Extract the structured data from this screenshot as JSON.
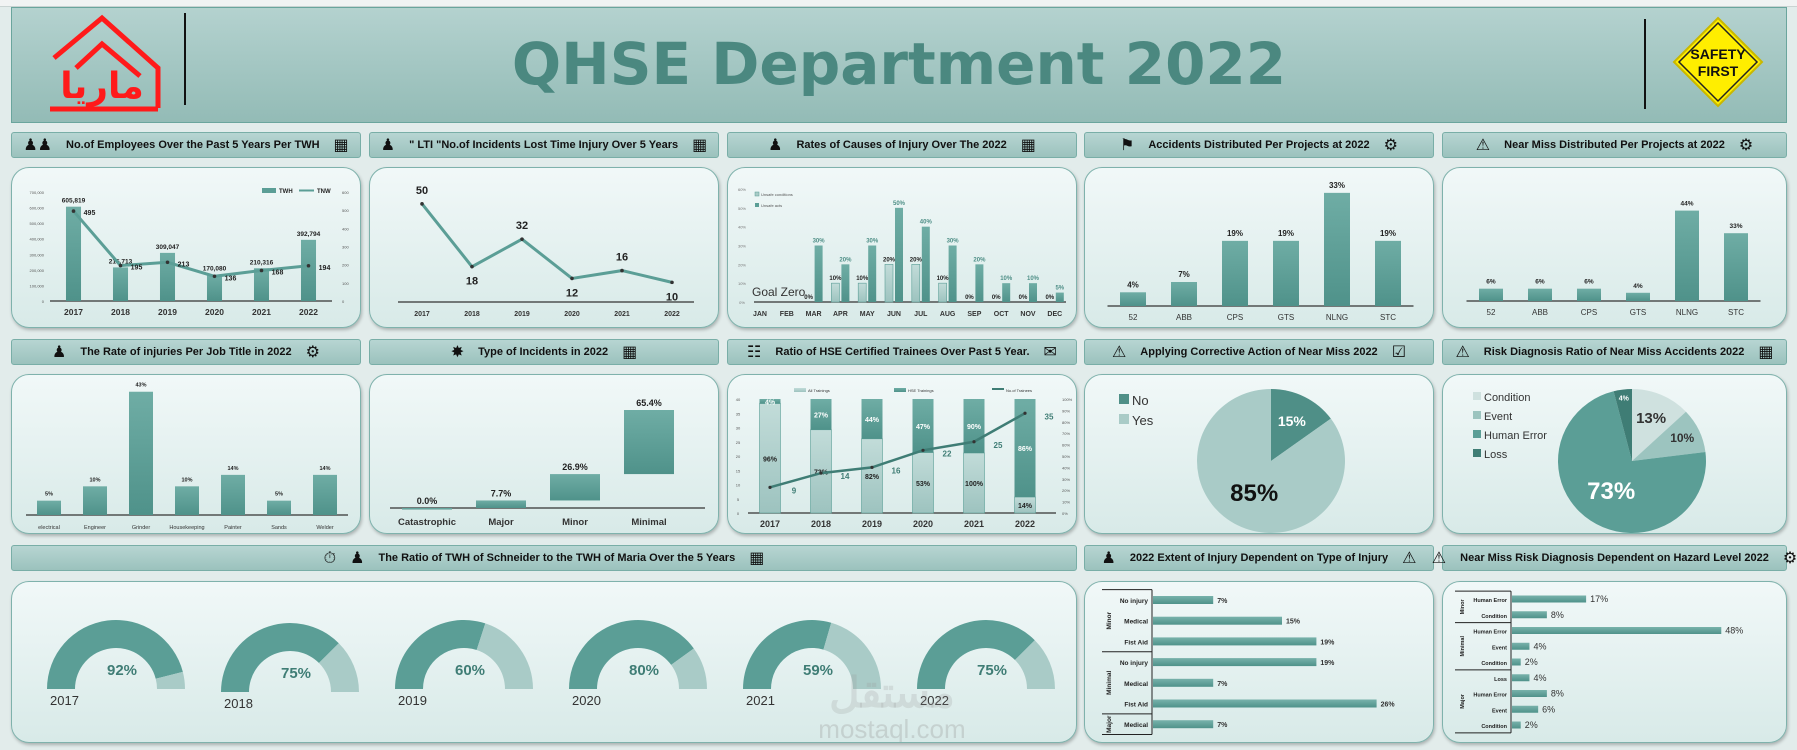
{
  "banner": {
    "title": "QHSE Department 2022",
    "logo_text": "ماريا",
    "sign_text": [
      "SAFETY",
      "FIRST"
    ],
    "watermark": [
      "مستقل",
      "mostaql.com"
    ]
  },
  "colors": {
    "bar": "#5b9e96",
    "bar_light": "#a9cbc7",
    "bar_dark": "#3f7d75",
    "title": "#4b8880",
    "logo": "#ff1a1a",
    "sign": "#ffee00"
  },
  "panels": [
    {
      "title": "No.of Employees Over the Past 5 Years Per TWH",
      "icons": [
        "people-icon",
        "calendar-clock-icon"
      ]
    },
    {
      "title": "\" LTI \"No.of Incidents Lost Time Injury Over 5 Years",
      "icons": [
        "injured-worker-icon",
        "calendar-clock-icon"
      ]
    },
    {
      "title": "Rates of Causes of Injury Over The 2022",
      "icons": [
        "injured-worker-icon",
        "calendar-clock-icon"
      ]
    },
    {
      "title": "Accidents Distributed Per Projects at 2022",
      "icons": [
        "falling-worker-icon",
        "gear-wrench-icon"
      ]
    },
    {
      "title": "Near Miss Distributed Per Projects at 2022",
      "icons": [
        "slipping-person-icon",
        "gear-wrench-icon"
      ]
    },
    {
      "title": "The Rate of injuries Per Job Title in 2022",
      "icons": [
        "injured-worker-icon",
        "gear-wrench-icon"
      ]
    },
    {
      "title": "Type of Incidents in 2022",
      "icons": [
        "accident-icon",
        "calendar-clock-icon"
      ]
    },
    {
      "title": "Ratio of HSE Certified Trainees Over Past 5 Year.",
      "icons": [
        "trainees-icon",
        "certificate-icon"
      ]
    },
    {
      "title": "Applying Corrective Action of Near Miss 2022",
      "icons": [
        "slipping-person-icon",
        "clipboard-check-icon"
      ]
    },
    {
      "title": "Risk Diagnosis Ratio of Near Miss Accidents 2022",
      "icons": [
        "slipping-person-icon",
        "calendar-clock-icon"
      ]
    },
    {
      "title": "The Ratio of TWH of Schneider to the TWH of Maria Over the 5 Years",
      "icons": [
        "stopwatch-icon",
        "worker-icon",
        "calendar-clock-icon"
      ]
    },
    {
      "title": "2022 Extent of Injury Dependent on Type of Injury",
      "icons": [
        "injured-worker-icon",
        "falling-person-icon"
      ]
    },
    {
      "title": "Near Miss Risk Diagnosis Dependent on Hazard Level 2022",
      "icons": [
        "slipping-person-icon",
        "gear-wrench-icon"
      ]
    }
  ],
  "chart_data": [
    {
      "type": "bar+line",
      "categories": [
        "2017",
        "2018",
        "2019",
        "2020",
        "2021",
        "2022"
      ],
      "series": [
        {
          "name": "TWH",
          "values": [
            605819,
            215713,
            309047,
            170080,
            210316,
            392794
          ],
          "axis": "left"
        },
        {
          "name": "TNW",
          "values": [
            495,
            195,
            213,
            136,
            168,
            194
          ],
          "axis": "right"
        }
      ],
      "ylim": [
        0,
        700000
      ],
      "y2lim": [
        0,
        600
      ],
      "yticks": [
        "0",
        "100,000",
        "200,000",
        "300,000",
        "400,000",
        "500,000",
        "600,000",
        "700,000"
      ],
      "y2ticks": [
        "0",
        "100",
        "200",
        "300",
        "400",
        "500",
        "600"
      ],
      "legend": "top-right"
    },
    {
      "type": "line",
      "categories": [
        "2017",
        "2018",
        "2019",
        "2020",
        "2021",
        "2022"
      ],
      "values": [
        50,
        18,
        32,
        12,
        16,
        10
      ],
      "ylim": [
        0,
        55
      ]
    },
    {
      "type": "bar",
      "categories": [
        "JAN",
        "FEB",
        "MAR",
        "APR",
        "MAY",
        "JUN",
        "JUL",
        "AUG",
        "SEP",
        "OCT",
        "NOV",
        "DEC"
      ],
      "series": [
        {
          "name": "Unsafe conditions",
          "values": [
            null,
            null,
            0,
            10,
            10,
            20,
            20,
            10,
            0,
            0,
            0,
            0
          ]
        },
        {
          "name": "Unsafe acts",
          "values": [
            null,
            null,
            30,
            20,
            30,
            50,
            40,
            30,
            20,
            10,
            10,
            5
          ]
        }
      ],
      "ylim": [
        0,
        60
      ],
      "yticks": [
        "0%",
        "10%",
        "20%",
        "30%",
        "40%",
        "50%",
        "60%"
      ],
      "annotation": "Goal Zero",
      "legend": "top-left"
    },
    {
      "type": "bar",
      "categories": [
        "52",
        "ABB",
        "CPS",
        "GTS",
        "NLNG",
        "STC"
      ],
      "values": [
        4,
        7,
        19,
        19,
        33,
        19
      ],
      "unit": "%"
    },
    {
      "type": "bar",
      "categories": [
        "52",
        "ABB",
        "CPS",
        "GTS",
        "NLNG",
        "STC"
      ],
      "values": [
        6,
        6,
        6,
        4,
        44,
        33
      ],
      "unit": "%"
    },
    {
      "type": "bar",
      "categories": [
        "electrical",
        "Engineer",
        "Grinder",
        "Housekeeping",
        "Painter",
        "Sands",
        "Welder"
      ],
      "values": [
        5,
        10,
        43,
        10,
        14,
        5,
        14
      ],
      "unit": "%"
    },
    {
      "type": "waterfall",
      "categories": [
        "Catastrophic",
        "Major",
        "Minor",
        "Minimal"
      ],
      "values": [
        0.0,
        7.7,
        26.9,
        65.4
      ],
      "labels": [
        "0.0%",
        "7.7%",
        "26.9%",
        "65.4%"
      ]
    },
    {
      "type": "stacked-bar+line",
      "categories": [
        "2017",
        "2018",
        "2019",
        "2020",
        "2021",
        "2022"
      ],
      "series": [
        {
          "name": "All Trainings",
          "values": [
            96,
            73,
            82,
            53,
            100,
            14
          ]
        },
        {
          "name": "HSE Trainings",
          "values": [
            4,
            27,
            44,
            47,
            90,
            86
          ]
        },
        {
          "name": "No.of Trainees",
          "values": [
            9,
            14,
            16,
            22,
            25,
            35
          ],
          "axis": "left"
        }
      ],
      "ylim": [
        0,
        40
      ],
      "yticks": [
        "0",
        "5",
        "10",
        "15",
        "20",
        "25",
        "30",
        "35",
        "40"
      ],
      "y2ticks": [
        "0%",
        "10%",
        "20%",
        "30%",
        "40%",
        "50%",
        "60%",
        "70%",
        "80%",
        "90%",
        "100%"
      ],
      "legend": "top"
    },
    {
      "type": "pie",
      "labels": [
        "No",
        "Yes"
      ],
      "values": [
        15,
        85
      ],
      "legend": "top-left"
    },
    {
      "type": "pie",
      "labels": [
        "Condition",
        "Event",
        "Human Error",
        "Loss"
      ],
      "values": [
        13,
        10,
        73,
        4
      ],
      "legend": "left"
    },
    {
      "type": "gauge",
      "categories": [
        "2017",
        "2018",
        "2019",
        "2020",
        "2021",
        "2022"
      ],
      "values": [
        92,
        75,
        60,
        80,
        59,
        75
      ]
    },
    {
      "type": "hbar",
      "groups": [
        {
          "name": "Minor",
          "items": [
            {
              "label": "No injury",
              "value": 7
            },
            {
              "label": "Medical",
              "value": 15
            },
            {
              "label": "Fist Aid",
              "value": 19
            }
          ]
        },
        {
          "name": "Minimal",
          "items": [
            {
              "label": "No injury",
              "value": 19
            },
            {
              "label": "Medical",
              "value": 7
            },
            {
              "label": "Fist Aid",
              "value": 26
            }
          ]
        },
        {
          "name": "Major",
          "items": [
            {
              "label": "Medical",
              "value": 7
            }
          ]
        }
      ],
      "unit": "%"
    },
    {
      "type": "hbar",
      "groups": [
        {
          "name": "Minor",
          "items": [
            {
              "label": "Human Error",
              "value": 17
            },
            {
              "label": "Condition",
              "value": 8
            }
          ]
        },
        {
          "name": "Minimal",
          "items": [
            {
              "label": "Human Error",
              "value": 48
            },
            {
              "label": "Event",
              "value": 4
            },
            {
              "label": "Condition",
              "value": 2
            }
          ]
        },
        {
          "name": "Major",
          "items": [
            {
              "label": "Loss",
              "value": 4
            },
            {
              "label": "Human Error",
              "value": 8
            },
            {
              "label": "Event",
              "value": 6
            },
            {
              "label": "Condition",
              "value": 2
            }
          ]
        }
      ],
      "unit": "%"
    }
  ]
}
